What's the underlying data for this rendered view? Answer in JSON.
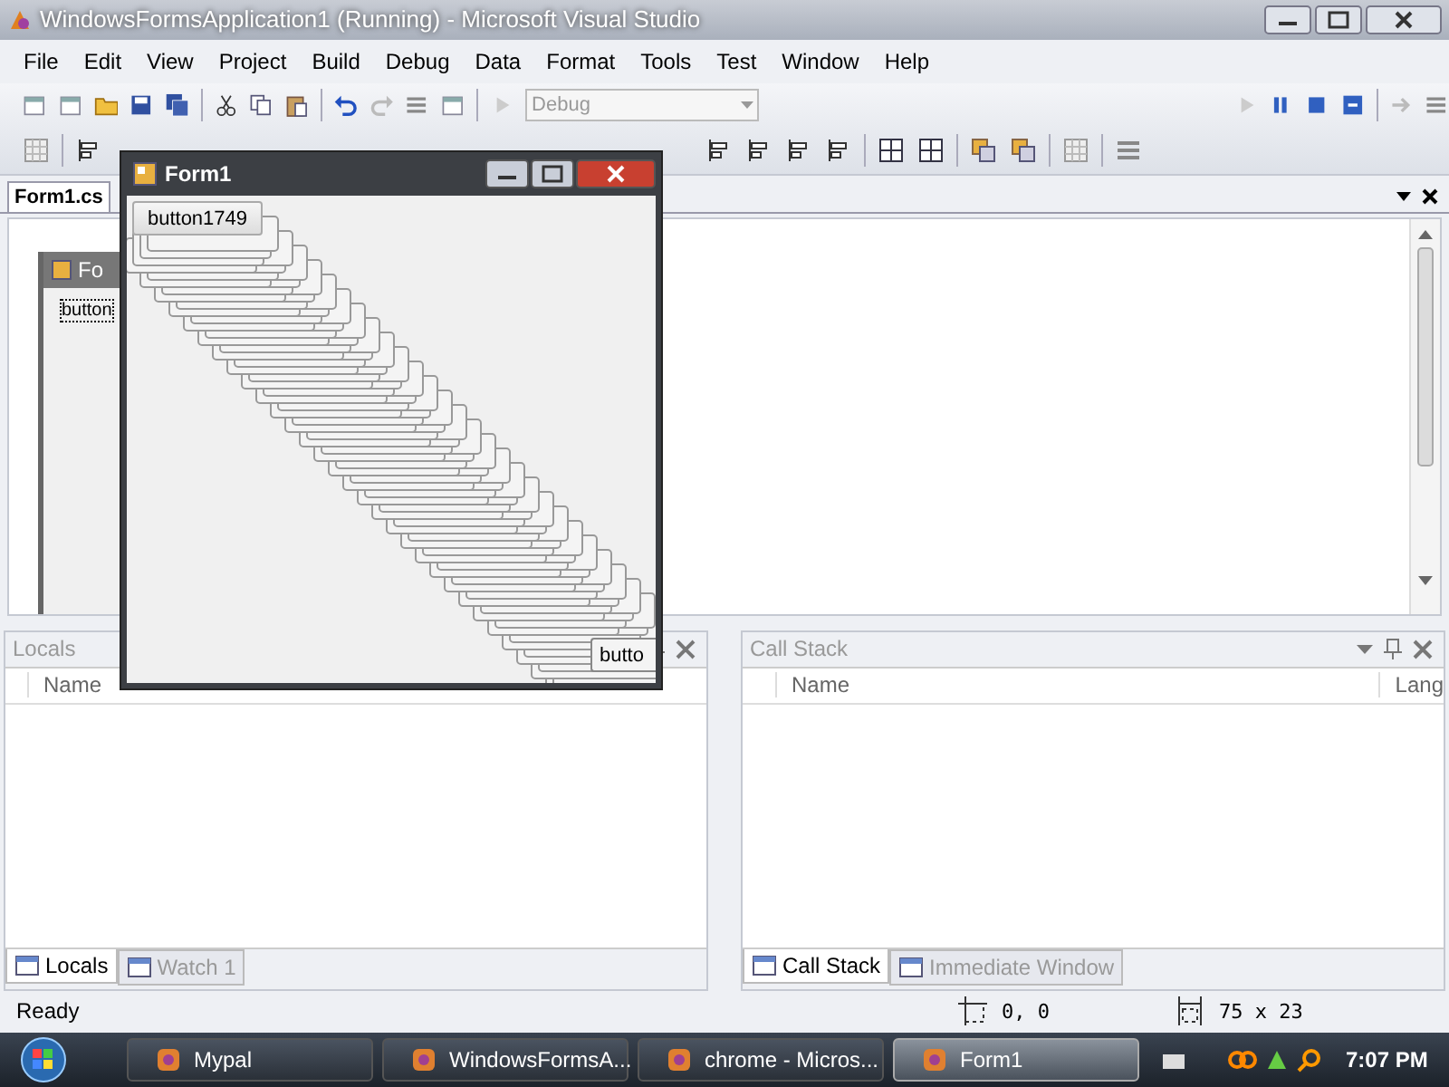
{
  "window": {
    "title": "WindowsFormsApplication1 (Running) - Microsoft Visual Studio"
  },
  "menu": [
    "File",
    "Edit",
    "View",
    "Project",
    "Build",
    "Debug",
    "Data",
    "Format",
    "Tools",
    "Test",
    "Window",
    "Help"
  ],
  "toolbar": {
    "configuration": "Debug"
  },
  "document_tabs": [
    {
      "label": "Form1.cs",
      "selected": true
    }
  ],
  "designer": {
    "form_title": "Fo",
    "button_label": "button"
  },
  "running_form": {
    "title": "Form1",
    "first_button": "button1749",
    "last_button": "butto"
  },
  "panels": [
    {
      "title": "Locals",
      "columns": [
        "Name"
      ],
      "tabs": [
        {
          "label": "Locals",
          "selected": true
        },
        {
          "label": "Watch 1",
          "selected": false
        }
      ]
    },
    {
      "title": "Call Stack",
      "columns": [
        "Name",
        "Lang"
      ],
      "tabs": [
        {
          "label": "Call Stack",
          "selected": true
        },
        {
          "label": "Immediate Window",
          "selected": false
        }
      ]
    }
  ],
  "status_bar": {
    "text": "Ready",
    "position": "0, 0",
    "size": "75 x 23"
  },
  "taskbar": {
    "items": [
      {
        "label": "Mypal",
        "selected": false
      },
      {
        "label": "WindowsFormsA...",
        "selected": false
      },
      {
        "label": "chrome - Micros...",
        "selected": false
      },
      {
        "label": "Form1",
        "selected": true
      }
    ],
    "clock": "7:07 PM"
  }
}
